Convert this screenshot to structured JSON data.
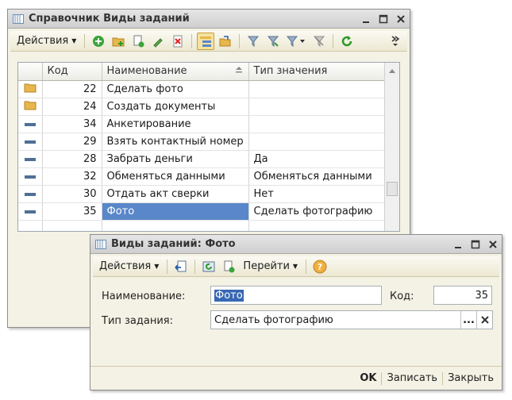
{
  "main_window": {
    "title": "Справочник Виды заданий",
    "actions_label": "Действия",
    "columns": [
      "Код",
      "Наименование",
      "Тип значения"
    ],
    "rows": [
      {
        "icon": "folder-icon",
        "code": "22",
        "name": "Сделать фото",
        "type": ""
      },
      {
        "icon": "item-icon",
        "code": "24",
        "name": "Создать документы",
        "type": "",
        "folder": true
      },
      {
        "icon": "item-icon",
        "code": "34",
        "name": "Анкетирование",
        "type": ""
      },
      {
        "icon": "item-icon",
        "code": "29",
        "name": "Взять контактный номер",
        "type": ""
      },
      {
        "icon": "item-icon",
        "code": "28",
        "name": "Забрать деньги",
        "type": "Да"
      },
      {
        "icon": "item-icon",
        "code": "32",
        "name": "Обменяться данными",
        "type": "Обменяться данными"
      },
      {
        "icon": "item-icon",
        "code": "30",
        "name": "Отдать акт сверки",
        "type": "Нет"
      },
      {
        "icon": "item-icon",
        "code": "35",
        "name": "Фото",
        "type": "Сделать фотографию",
        "selected": true
      }
    ]
  },
  "dialog": {
    "title": "Виды заданий: Фото",
    "actions_label": "Действия",
    "goto_label": "Перейти",
    "name_label": "Наименование:",
    "name_value": "Фото",
    "code_label": "Код:",
    "code_value": "35",
    "type_label": "Тип задания:",
    "type_value": "Сделать фотографию",
    "ellipsis": "...",
    "ok_label": "OK",
    "save_label": "Записать",
    "close_label": "Закрыть"
  },
  "colors": {
    "selection": "#5987c9",
    "window_bg": "#f4f2e4",
    "folder": "#e8b64c"
  }
}
